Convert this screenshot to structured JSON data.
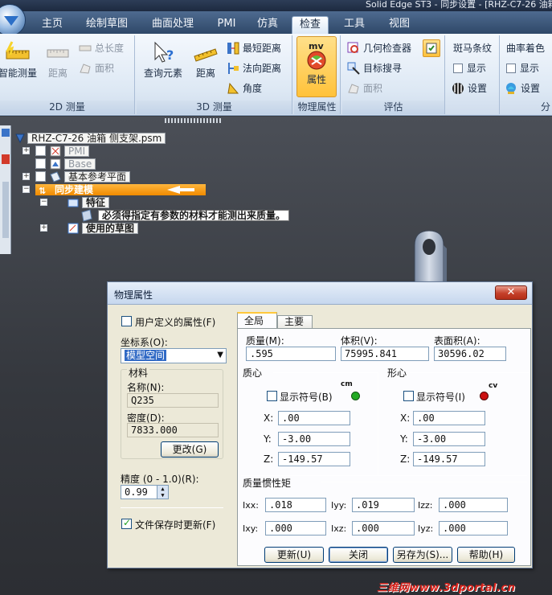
{
  "title_bar": {
    "title": "Solid Edge ST3 - 同步设置 - [RHZ-C7-26 油箱"
  },
  "tabs": [
    {
      "label": "主页"
    },
    {
      "label": "绘制草图"
    },
    {
      "label": "曲面处理"
    },
    {
      "label": "PMI"
    },
    {
      "label": "仿真"
    },
    {
      "label": "检查"
    },
    {
      "label": "工具"
    },
    {
      "label": "视图"
    }
  ],
  "ribbon": {
    "group_2d": {
      "label": "2D 测量",
      "smart_measure": "智能测量",
      "distance": "距离",
      "total_length": "总长度",
      "area": "面积"
    },
    "group_3d": {
      "label": "3D 测量",
      "query_element": "查询元素",
      "distance": "距离",
      "min_distance": "最短距离",
      "normal_distance": "法向距离",
      "angle": "角度"
    },
    "group_physical": {
      "label": "物理属性",
      "properties": "属性",
      "mv_tag": "mv"
    },
    "group_evaluate": {
      "label": "评估",
      "geometry_inspector": "几何检查器",
      "target_finder": "目标搜寻",
      "area": "面积"
    },
    "group_zebra": {
      "title": "斑马条纹",
      "show": "显示",
      "settings": "设置"
    },
    "group_curvature": {
      "title": "曲率着色",
      "show": "显示",
      "settings": "设置",
      "label": "分"
    }
  },
  "tree": {
    "root": "RHZ-C7-26 油箱 侧支架.psm",
    "pmi": "PMI",
    "base": "Base",
    "ref_planes": "基本参考平面",
    "sync_modeling": "同步建模",
    "features": "特征",
    "tooltip": "必须得指定有参数的材料才能测出来质量。",
    "used_sketches": "使用的草图"
  },
  "dialog": {
    "title": "物理属性",
    "close_glyph": "✕",
    "user_defined_label": "用户定义的属性(F)",
    "user_defined_checked": false,
    "coord_label": "坐标系(O):",
    "coord_value": "模型空间",
    "material_title": "材料",
    "name_label": "名称(N):",
    "name_value": "Q235",
    "density_label": "密度(D):",
    "density_value": "7833.000",
    "change_button": "更改(G)",
    "precision_label": "精度 (0 - 1.0)(R):",
    "precision_value": "0.99",
    "update_on_save_label": "文件保存时更新(F)",
    "update_on_save_checked": true,
    "tab_global": "全局",
    "tab_principal": "主要",
    "mass_label": "质量(M):",
    "mass_value": ".595",
    "volume_label": "体积(V):",
    "volume_value": "75995.841",
    "surface_label": "表面积(A):",
    "surface_value": "30596.02",
    "centroid_title": "质心",
    "centroid_show_label": "显示符号(B)",
    "centroid_symbol": "cm",
    "centroid_x": ".00",
    "centroid_y": "-3.00",
    "centroid_z": "-149.57",
    "shape_center_title": "形心",
    "shape_center_show_label": "显示符号(I)",
    "shape_center_symbol": "cv",
    "shape_center_x": ".00",
    "shape_center_y": "-3.00",
    "shape_center_z": "-149.57",
    "x_label": "X:",
    "y_label": "Y:",
    "z_label": "Z:",
    "inertia_title": "质量惯性矩",
    "ixx_label": "Ixx:",
    "ixx_value": ".018",
    "iyy_label": "Iyy:",
    "iyy_value": ".019",
    "izz_label": "Izz:",
    "izz_value": ".000",
    "ixy_label": "Ixy:",
    "ixy_value": ".000",
    "ixz_label": "Ixz:",
    "ixz_value": ".000",
    "iyz_label": "Iyz:",
    "iyz_value": ".000",
    "update_button": "更新(U)",
    "close_button": "关闭",
    "save_as_button": "另存为(S)...",
    "help_button": "帮助(H)"
  },
  "watermark": "三维网www.3dportal.cn",
  "colors": {
    "cm_dot": "#22aa22",
    "cv_dot": "#cc1111",
    "selection": "#f08a00"
  }
}
